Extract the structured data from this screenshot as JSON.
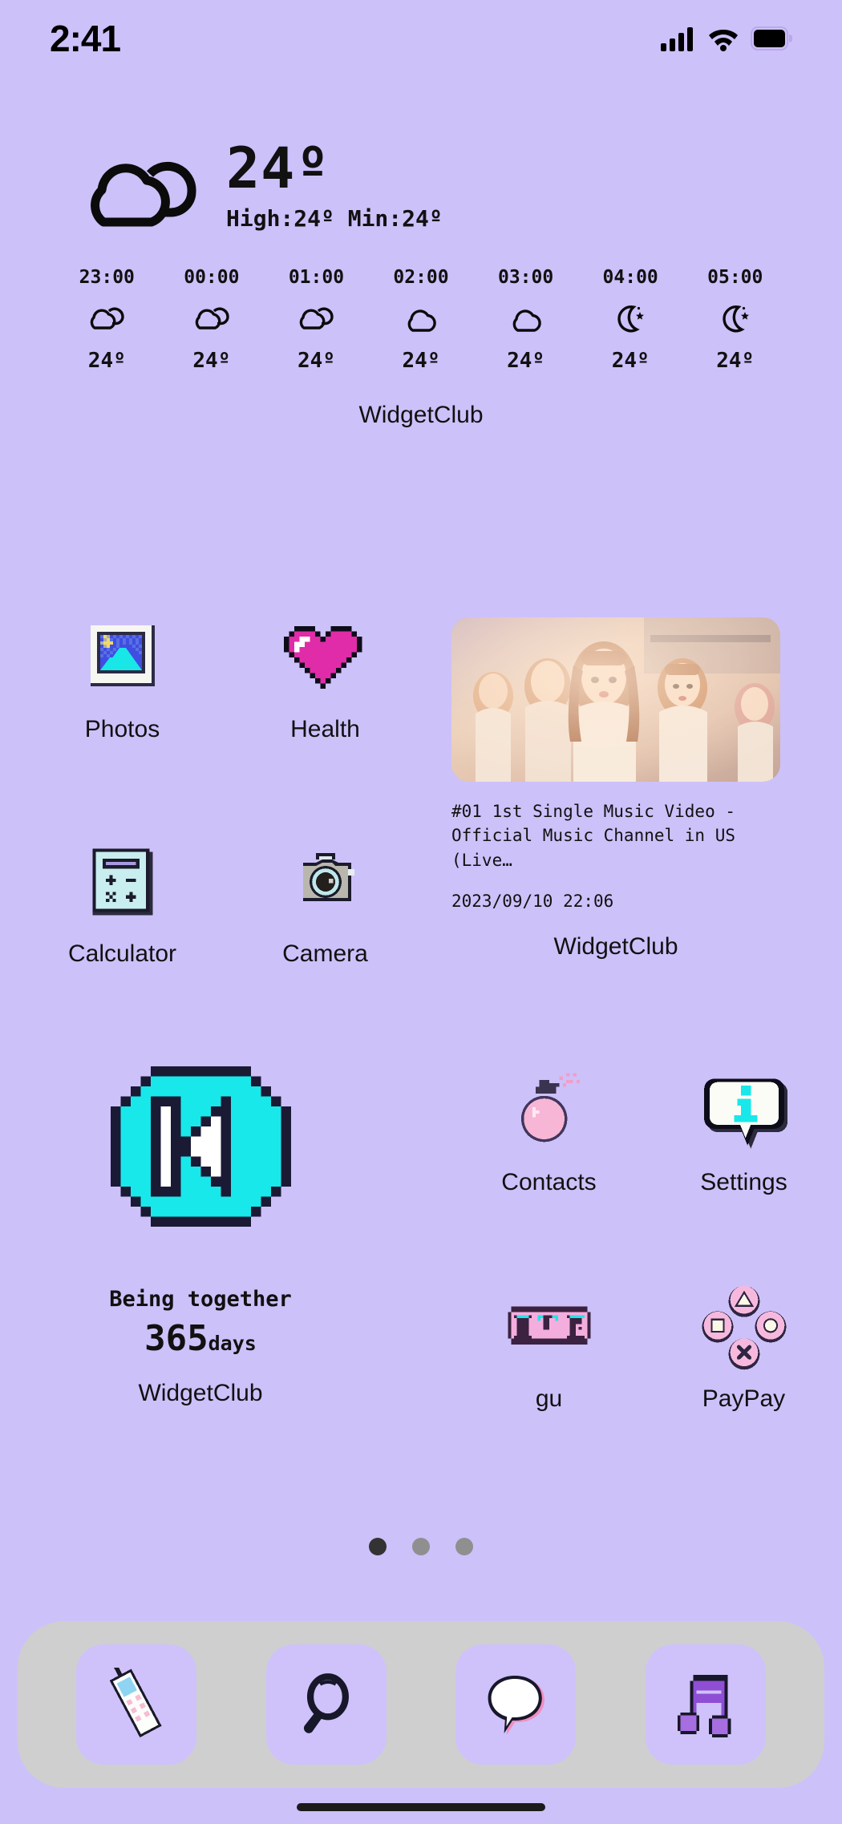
{
  "theme": {
    "background": "#cdc1fa",
    "dock_background": "#cfcfcf",
    "dock_tile": "#cfc2fb",
    "accent_cyan": "#1ee8e8",
    "accent_pink": "#e941ab",
    "text": "#111111"
  },
  "status_bar": {
    "time": "2:41",
    "cellular_icon": "signal-bars-icon",
    "wifi_icon": "wifi-icon",
    "battery_icon": "battery-full-icon"
  },
  "weather_widget": {
    "condition_icon": "cloudy-icon",
    "current_temp": "24º",
    "high_low": "High:24º Min:24º",
    "hourly": [
      {
        "time": "23:00",
        "icon": "cloudy-icon",
        "temp": "24º"
      },
      {
        "time": "00:00",
        "icon": "cloudy-icon",
        "temp": "24º"
      },
      {
        "time": "01:00",
        "icon": "cloudy-icon",
        "temp": "24º"
      },
      {
        "time": "02:00",
        "icon": "cloud-icon",
        "temp": "24º"
      },
      {
        "time": "03:00",
        "icon": "cloud-icon",
        "temp": "24º"
      },
      {
        "time": "04:00",
        "icon": "moon-stars-icon",
        "temp": "24º"
      },
      {
        "time": "05:00",
        "icon": "moon-stars-icon",
        "temp": "24º"
      }
    ],
    "caption": "WidgetClub"
  },
  "apps": {
    "photos": {
      "label": "Photos",
      "icon": "photos-icon"
    },
    "health": {
      "label": "Health",
      "icon": "pixel-heart-icon"
    },
    "calculator": {
      "label": "Calculator",
      "icon": "calculator-icon"
    },
    "camera": {
      "label": "Camera",
      "icon": "camera-icon"
    },
    "contacts": {
      "label": "Contacts",
      "icon": "bomb-icon"
    },
    "settings": {
      "label": "Settings",
      "icon": "info-bubble-icon"
    },
    "gu": {
      "label": "gu",
      "icon": "omg-icon"
    },
    "paypay": {
      "label": "PayPay",
      "icon": "gamepad-buttons-icon"
    }
  },
  "video_widget": {
    "title": "#01 1st Single Music Video -\nOfficial Music Channel in US (Live…",
    "title_line1": "#01 1st Single Music Video -",
    "title_line2": "Official Music Channel in US (Live…",
    "date": "2023/09/10 22:06",
    "caption": "WidgetClub"
  },
  "music_widget": {
    "icon": "previous-track-icon",
    "caption": "WidgetClub"
  },
  "counter_widget": {
    "title": "Being together",
    "number": "365",
    "unit": "days",
    "caption": "WidgetClub"
  },
  "page_dots": {
    "total": 3,
    "active_index": 0
  },
  "dock": [
    {
      "name": "phone",
      "icon": "flip-phone-icon"
    },
    {
      "name": "search",
      "icon": "magnifier-icon"
    },
    {
      "name": "messages",
      "icon": "speech-bubble-icon"
    },
    {
      "name": "music",
      "icon": "music-note-icon"
    }
  ]
}
